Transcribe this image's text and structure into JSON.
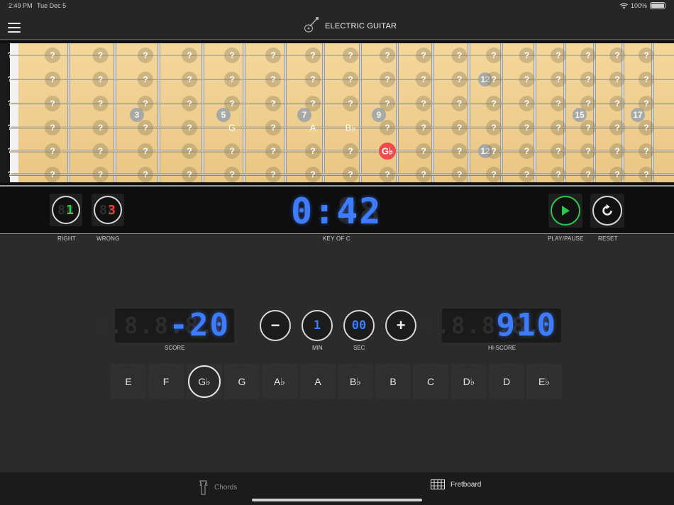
{
  "status": {
    "time": "2:49 PM",
    "date": "Tue Dec 5",
    "battery": "100%"
  },
  "header": {
    "title": "ELECTRIC GUITAR",
    "menu_icon": "hamburger-icon",
    "instrument_icon": "guitar-icon"
  },
  "fretboard": {
    "unknown_mark": "?",
    "open_string_mark": "?",
    "inlay_numbers": [
      "3",
      "5",
      "7",
      "9",
      "12",
      "15",
      "17"
    ],
    "revealed_notes": [
      "G",
      "A",
      "B♭"
    ],
    "highlighted_note": "G♭",
    "highlight_color": "#f04a4a"
  },
  "controls": {
    "right_value": "1",
    "right_ghost": "88",
    "wrong_value": "3",
    "wrong_ghost": "88",
    "timer": "0:42",
    "timer_ghost": "8:88",
    "right_label": "RIGHT",
    "wrong_label": "WRONG",
    "key_label": "KEY OF C",
    "play_label": "PLAY/PAUSE",
    "reset_label": "RESET"
  },
  "score": {
    "score_value": "-20",
    "score_ghost": "8.8.8.8.8",
    "score_label": "SCORE",
    "minus": "−",
    "plus": "+",
    "min_value": "1",
    "min_label": "MIN",
    "sec_value": "00",
    "sec_label": "SEC",
    "hiscore_value": "910",
    "hiscore_ghost": "8.8.8.8.8",
    "hiscore_label": "HI-SCORE"
  },
  "notes": [
    "E",
    "F",
    "G♭",
    "G",
    "A♭",
    "A",
    "B♭",
    "B",
    "C",
    "D♭",
    "D",
    "E♭"
  ],
  "selected_note": "G♭",
  "tabs": [
    {
      "label": "Chords",
      "icon": "guitar-headstock-icon",
      "active": false
    },
    {
      "label": "Fretboard",
      "icon": "fretboard-icon",
      "active": true
    }
  ],
  "colors": {
    "digit_blue": "#3d7cff",
    "digit_green": "#27d04b",
    "digit_red": "#ff3a3a",
    "play_green": "#2fc44b"
  }
}
